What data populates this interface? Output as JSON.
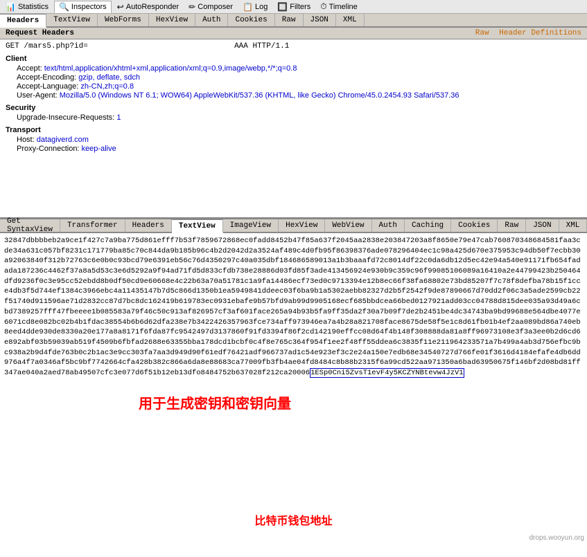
{
  "toolbar": {
    "items": [
      {
        "id": "statistics",
        "label": "Statistics",
        "icon": "📊"
      },
      {
        "id": "inspectors",
        "label": "Inspectors",
        "icon": "🔍"
      },
      {
        "id": "autoresponder",
        "label": "AutoResponder",
        "icon": "↩"
      },
      {
        "id": "composer",
        "label": "Composer",
        "icon": "✏"
      },
      {
        "id": "log",
        "label": "Log",
        "icon": "📋"
      },
      {
        "id": "filters",
        "label": "Filters",
        "icon": "🔲"
      },
      {
        "id": "timeline",
        "label": "Timeline",
        "icon": "⏱"
      }
    ]
  },
  "upper_tabs": [
    {
      "id": "headers",
      "label": "Headers",
      "active": true
    },
    {
      "id": "textview",
      "label": "TextView"
    },
    {
      "id": "webforms",
      "label": "WebForms"
    },
    {
      "id": "hexview",
      "label": "HexView"
    },
    {
      "id": "auth",
      "label": "Auth"
    },
    {
      "id": "cookies",
      "label": "Cookies"
    },
    {
      "id": "raw",
      "label": "Raw"
    },
    {
      "id": "json",
      "label": "JSON"
    },
    {
      "id": "xml",
      "label": "XML"
    }
  ],
  "request_headers_label": "Request Headers",
  "raw_link": "Raw",
  "header_definitions_link": "Header Definitions",
  "request_line": "GET /mars5.php?id=",
  "request_protocol": "AAA HTTP/1.1",
  "sections": [
    {
      "title": "Client",
      "headers": [
        {
          "key": "Accept:",
          "val": "text/html,application/xhtml+xml,application/xml;q=0.9,image/webp,*/*;q=0.8"
        },
        {
          "key": "Accept-Encoding:",
          "val": "gzip, deflate, sdch"
        },
        {
          "key": "Accept-Language:",
          "val": "zh-CN,zh;q=0.8"
        },
        {
          "key": "User-Agent:",
          "val": "Mozilla/5.0 (Windows NT 6.1; WOW64) AppleWebKit/537.36 (KHTML, like Gecko) Chrome/45.0.2454.93 Safari/537.36"
        }
      ]
    },
    {
      "title": "Security",
      "headers": [
        {
          "key": "Upgrade-Insecure-Requests:",
          "val": "1"
        }
      ]
    },
    {
      "title": "Transport",
      "headers": [
        {
          "key": "Host:",
          "val": "datagiverd.com"
        },
        {
          "key": "Proxy-Connection:",
          "val": "keep-alive"
        }
      ]
    }
  ],
  "bottom_tabs": [
    {
      "id": "get-syntaxview",
      "label": "Get SyntaxView"
    },
    {
      "id": "transformer",
      "label": "Transformer"
    },
    {
      "id": "headers",
      "label": "Headers"
    },
    {
      "id": "textview",
      "label": "TextView",
      "active": true
    },
    {
      "id": "imageview",
      "label": "ImageView"
    },
    {
      "id": "hexview",
      "label": "HexView"
    },
    {
      "id": "webview",
      "label": "WebView"
    },
    {
      "id": "auth",
      "label": "Auth"
    },
    {
      "id": "caching",
      "label": "Caching"
    },
    {
      "id": "cookies",
      "label": "Cookies"
    },
    {
      "id": "raw",
      "label": "Raw"
    },
    {
      "id": "json",
      "label": "JSON"
    },
    {
      "id": "xml",
      "label": "XML"
    }
  ],
  "hex_content": "32847dbbbbeb2a9ce1f427c7a9ba775d861efff7b53f7859672868ec0fadd8452b47f85a637f2045aa2838e203847203a8f8650e79e47cab760870348684581faa3cde34a631c057bf8231c171779ba85c70c844da9b185b96c4b2d2042d2a3524af489c4d0fb95f86398376ade078296404ec1c98a425d670e375953c94db50f7ecbb30a92063840f312b72763c6e0b0c93bcd79e6391eb56c76d4350297c40a035dbf184686589013a1b3baaafd72c8014df22c0da6db12d5ec42e94a540e91171fb654fadada187236c4462f37a8a5d53c3e6d5292a9f94ad71fd5d833cfdb738e28886d03fd85f3ade413456924e930b9c359c96f99085106089a16410a2e44799423b250464dfd9236f0c3e95cc52ebdd8b0df50cd9e60668e4c22b63a70a51781c1a9fa1",
  "hex_content2": "4486ecf73ed0c9713394e12b8ec66f38fa68802e73bd85207f7c78f8defba78b15f1cce4db3f5d744ef1384c3966ebc4a11435147b7d5c866d1350b1ea5949841ddeec03f6ba9b1a5302aebb82327d2b5f2542f9de87890667d70dd2f06c3a5ade2599cb22f51740d911596ae71d2832cc87d7bc8dc162419b619783ec0931ebafe9b57bfd9ab99d9905168ecf685bbdcea66bed0127921add03cc04788d815dee035a93d49a6cbd7389257fff47fbeeee1b085583a79f46c50c913af826957cf3af601face265a94b93b5fa9ff35da2f30a7b09f7de2b2451be4dc34743ba9bd99688e564dbe4077e6071cd8e082bc02b4b1fdac38554b6b6d62dfa238e7b3422426357963fce734aff973946ea7a4b28a821708face8675de58f5e1c8d61fb01b4ef2aa089bd86a740eb8eed4dde930de8330a20e177a8a8171f6fda87fc9542497d3137860f91fd3394f86f2cd142190effcc08d64f4b148f308888da81a8ff96973108e3f3a3ee0b2d6cd6e892abf03b59039ab519f4509b6fbfad2688e63355bba178dcd1bcbf0c4f8e765c364f954f1ee2f48ff55ddea6c3835f11e211964233571a7b499a4ab3d756efbc9bc938a2b9d4fde763b0c2b1ac3e9cc303fa7aa3d949d90f61edf76421adf966737ad1c54e923ef3c2e24a150e7edb68e34540727d766fe01f3616d4184efafe4db6dd976a4f7a0346af5bc9bf7742664cfa428b382c866a6da8e88683ca77009fb3fb4ae04fd8484c8b88b2315f6a99cd522aa971350a6bad63950675f146bf2d08bd81ff347ae040a2aed78ab49507cfc3e077d6f51b12eb13dfo8484752b637028f212ca20006",
  "btc_address": "1ESp0Cni5ZvsT1evF4y5KCZYNBtevw4JzV1",
  "annotation_text": "用于生成密钥和密钥向量",
  "btc_label": "比特币钱包地址",
  "watermark": "drops.wooyun.org"
}
